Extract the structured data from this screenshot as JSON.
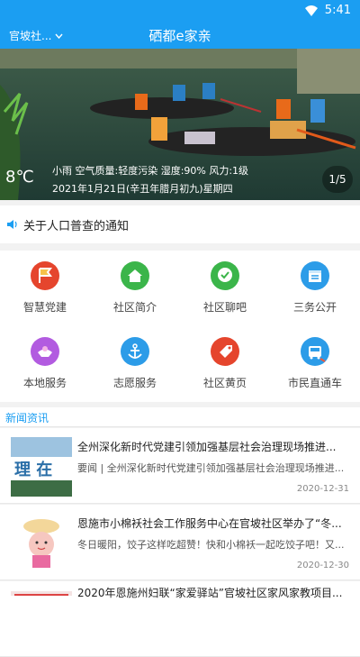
{
  "status": {
    "time": "5:41"
  },
  "app_bar": {
    "location": "官坡社...",
    "title": "硒都e家亲"
  },
  "banner": {
    "temperature": "8℃",
    "weather": "小雨 空气质量:轻度污染 湿度:90% 风力:1级",
    "date": "2021年1月21日(辛丑年腊月初九)星期四",
    "pager": "1/5"
  },
  "notice": {
    "text": "关于人口普查的通知"
  },
  "services": [
    {
      "label": "智慧党建",
      "color": "#e5452d",
      "icon": "party-flag-icon"
    },
    {
      "label": "社区简介",
      "color": "#3bb54a",
      "icon": "house-icon"
    },
    {
      "label": "社区聊吧",
      "color": "#3bb54a",
      "icon": "chat-icon"
    },
    {
      "label": "三务公开",
      "color": "#2c9ce8",
      "icon": "calendar-icon"
    },
    {
      "label": "本地服务",
      "color": "#b25be0",
      "icon": "handshake-icon"
    },
    {
      "label": "志愿服务",
      "color": "#2c9ce8",
      "icon": "anchor-icon"
    },
    {
      "label": "社区黄页",
      "color": "#e5452d",
      "icon": "tag-icon"
    },
    {
      "label": "市民直通车",
      "color": "#2c9ce8",
      "icon": "bus-icon"
    }
  ],
  "news": {
    "header": "新闻资讯",
    "items": [
      {
        "title": "全州深化新时代党建引领加强基层社会治理现场推进...",
        "summary": "要闻 | 全州深化新时代党建引领加强基层社会治理现场推进...",
        "date": "2020-12-31"
      },
      {
        "title": "恩施市小棉袄社会工作服务中心在官坡社区举办了“冬...",
        "summary": "冬日暖阳，饺子这样吃超赞！快和小棉袄一起吃饺子吧！又...",
        "date": "2020-12-30"
      },
      {
        "title": "2020年恩施州妇联“家爱驿站”官坡社区家风家教项目...",
        "summary": "",
        "date": ""
      }
    ]
  }
}
